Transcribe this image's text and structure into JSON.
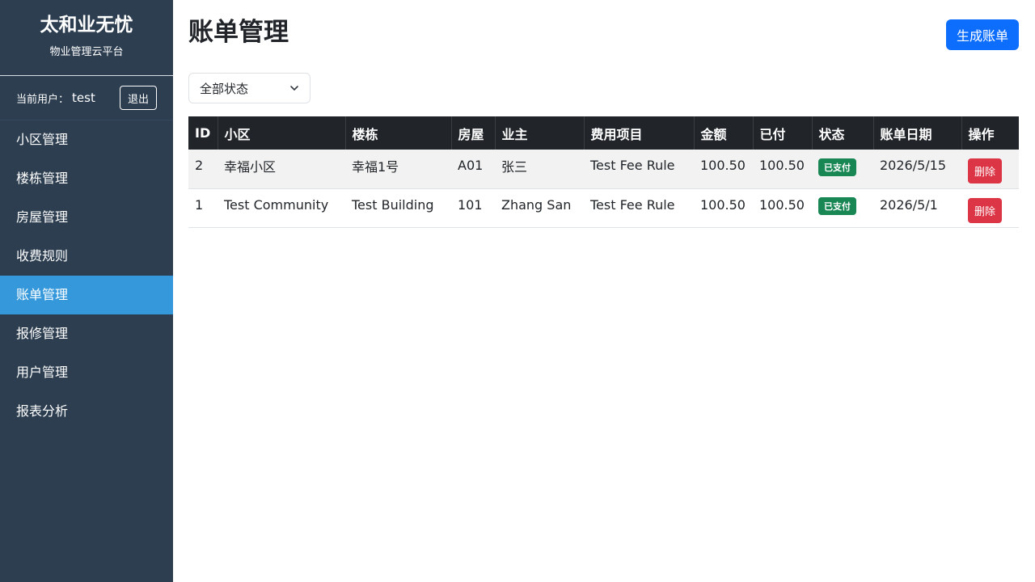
{
  "sidebar": {
    "brand_title": "太和业无忧",
    "brand_subtitle": "物业管理云平台",
    "user_label": "当前用户：",
    "user_name": "test",
    "logout_label": "退出",
    "items": [
      {
        "label": "小区管理",
        "active": false
      },
      {
        "label": "楼栋管理",
        "active": false
      },
      {
        "label": "房屋管理",
        "active": false
      },
      {
        "label": "收费规则",
        "active": false
      },
      {
        "label": "账单管理",
        "active": true
      },
      {
        "label": "报修管理",
        "active": false
      },
      {
        "label": "用户管理",
        "active": false
      },
      {
        "label": "报表分析",
        "active": false
      }
    ]
  },
  "header": {
    "title": "账单管理",
    "generate_label": "生成账单"
  },
  "filter": {
    "selected": "全部状态",
    "icon": "chevron-down-icon"
  },
  "table": {
    "columns": [
      "ID",
      "小区",
      "楼栋",
      "房屋",
      "业主",
      "费用项目",
      "金额",
      "已付",
      "状态",
      "账单日期",
      "操作"
    ],
    "rows": [
      {
        "id": "2",
        "community": "幸福小区",
        "building": "幸福1号",
        "house": "A01",
        "owner": "张三",
        "fee_item": "Test Fee Rule",
        "amount": "100.50",
        "paid": "100.50",
        "status": "已支付",
        "date": "2026/5/15",
        "action": "删除"
      },
      {
        "id": "1",
        "community": "Test Community",
        "building": "Test Building",
        "house": "101",
        "owner": "Zhang San",
        "fee_item": "Test Fee Rule",
        "amount": "100.50",
        "paid": "100.50",
        "status": "已支付",
        "date": "2026/5/1",
        "action": "删除"
      }
    ]
  },
  "colors": {
    "sidebar_bg": "#2c3e50",
    "active_item": "#3498db",
    "primary_button": "#0d6efd",
    "status_paid": "#198754",
    "delete_button": "#dc3545",
    "table_header": "#212529"
  }
}
